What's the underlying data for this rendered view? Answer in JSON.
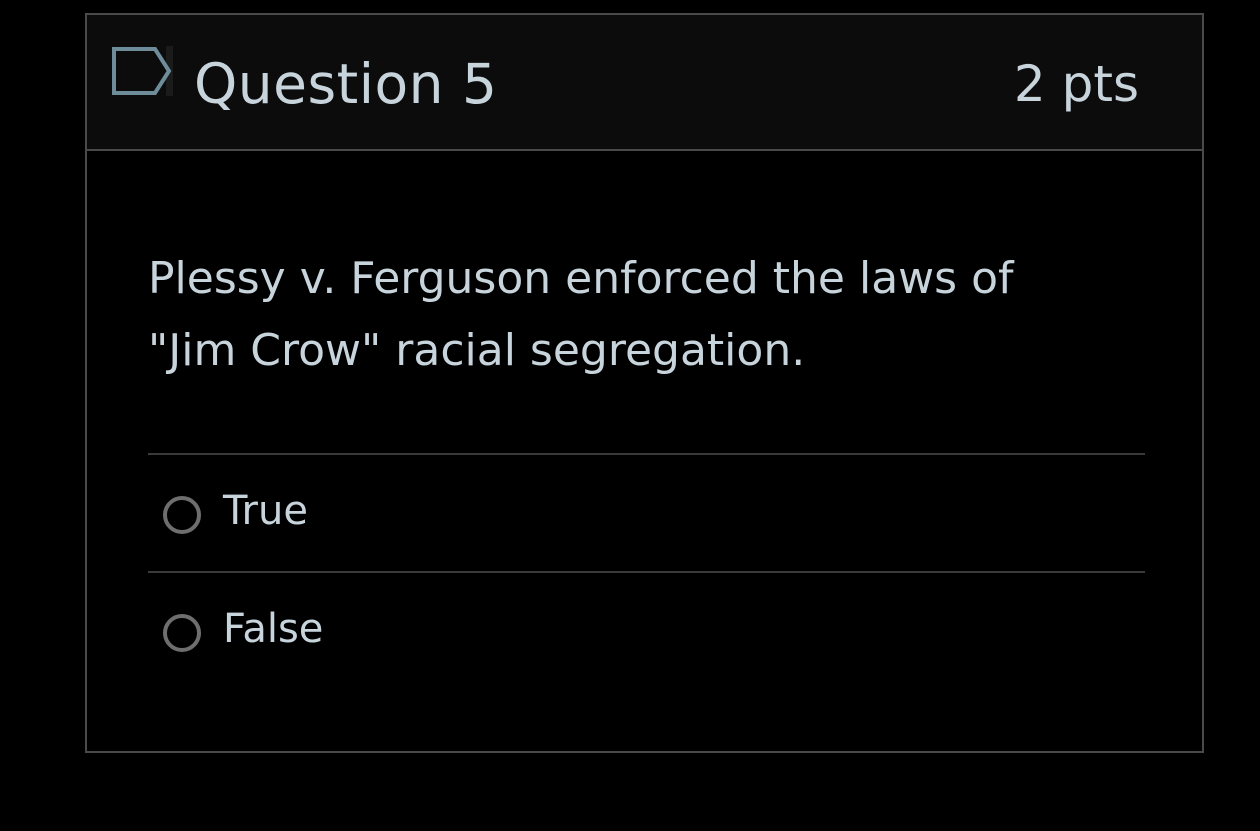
{
  "question": {
    "title": "Question 5",
    "points": "2 pts",
    "flag_icon": "flag-icon",
    "text": "Plessy v. Ferguson enforced the laws of \"Jim Crow\" racial segregation."
  },
  "answers": [
    {
      "label": "True",
      "selected": false
    },
    {
      "label": "False",
      "selected": false
    }
  ],
  "colors": {
    "background": "#000000",
    "header_background": "#0c0c0c",
    "text": "#c8d4dc",
    "border": "#4a4a4a",
    "radio_border": "#6e6e6e"
  }
}
